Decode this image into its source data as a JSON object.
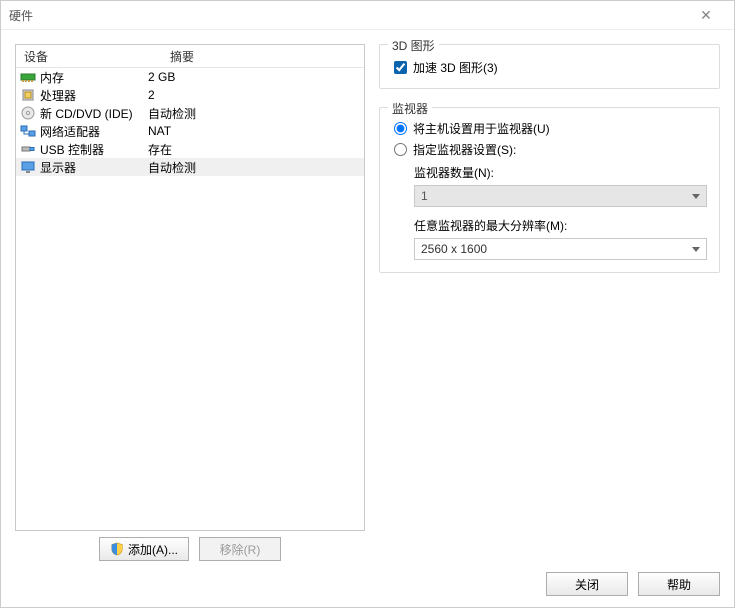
{
  "window": {
    "title": "硬件"
  },
  "list": {
    "headers": {
      "device": "设备",
      "summary": "摘要"
    },
    "rows": [
      {
        "icon": "memory-icon",
        "name": "内存",
        "summary": "2 GB",
        "selected": false
      },
      {
        "icon": "cpu-icon",
        "name": "处理器",
        "summary": "2",
        "selected": false
      },
      {
        "icon": "disc-icon",
        "name": "新 CD/DVD (IDE)",
        "summary": "自动检测",
        "selected": false
      },
      {
        "icon": "network-icon",
        "name": "网络适配器",
        "summary": "NAT",
        "selected": false
      },
      {
        "icon": "usb-icon",
        "name": "USB 控制器",
        "summary": "存在",
        "selected": false
      },
      {
        "icon": "display-icon",
        "name": "显示器",
        "summary": "自动检测",
        "selected": true
      }
    ]
  },
  "buttons": {
    "add": "添加(A)...",
    "remove": "移除(R)"
  },
  "group3d": {
    "title": "3D 图形",
    "accelLabel": "加速 3D 图形(3)",
    "accelChecked": true
  },
  "groupMonitor": {
    "title": "监视器",
    "radioHost": "将主机设置用于监视器(U)",
    "radioSpecify": "指定监视器设置(S):",
    "radioSelected": "host",
    "countLabel": "监视器数量(N):",
    "countValue": "1",
    "maxResLabel": "任意监视器的最大分辨率(M):",
    "maxResValue": "2560 x 1600"
  },
  "footer": {
    "close": "关闭",
    "help": "帮助"
  }
}
